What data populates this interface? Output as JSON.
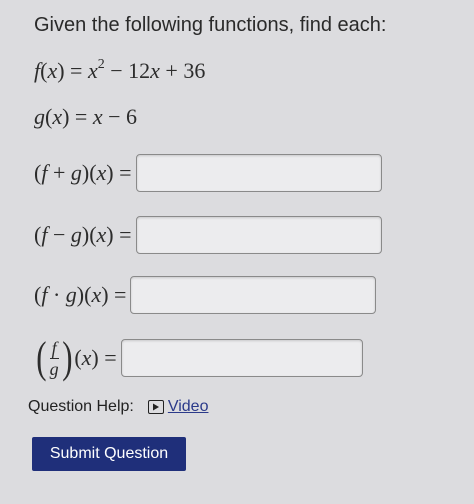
{
  "question": {
    "prompt": "Given the following functions, find each:",
    "f_definition": {
      "name": "f(x)",
      "expression": "x² − 12x + 36"
    },
    "g_definition": {
      "name": "g(x)",
      "expression": "x − 6"
    },
    "parts": [
      {
        "label": "(f + g)(x) =",
        "value": ""
      },
      {
        "label": "(f − g)(x) =",
        "value": ""
      },
      {
        "label": "(f · g)(x) =",
        "value": ""
      },
      {
        "label": "(f/g)(x) =",
        "value": ""
      }
    ]
  },
  "help": {
    "label": "Question Help:",
    "video_link": "Video",
    "video_icon": "play-video-icon"
  },
  "submit": {
    "label": "Submit Question",
    "color": "#1f2f7a"
  }
}
